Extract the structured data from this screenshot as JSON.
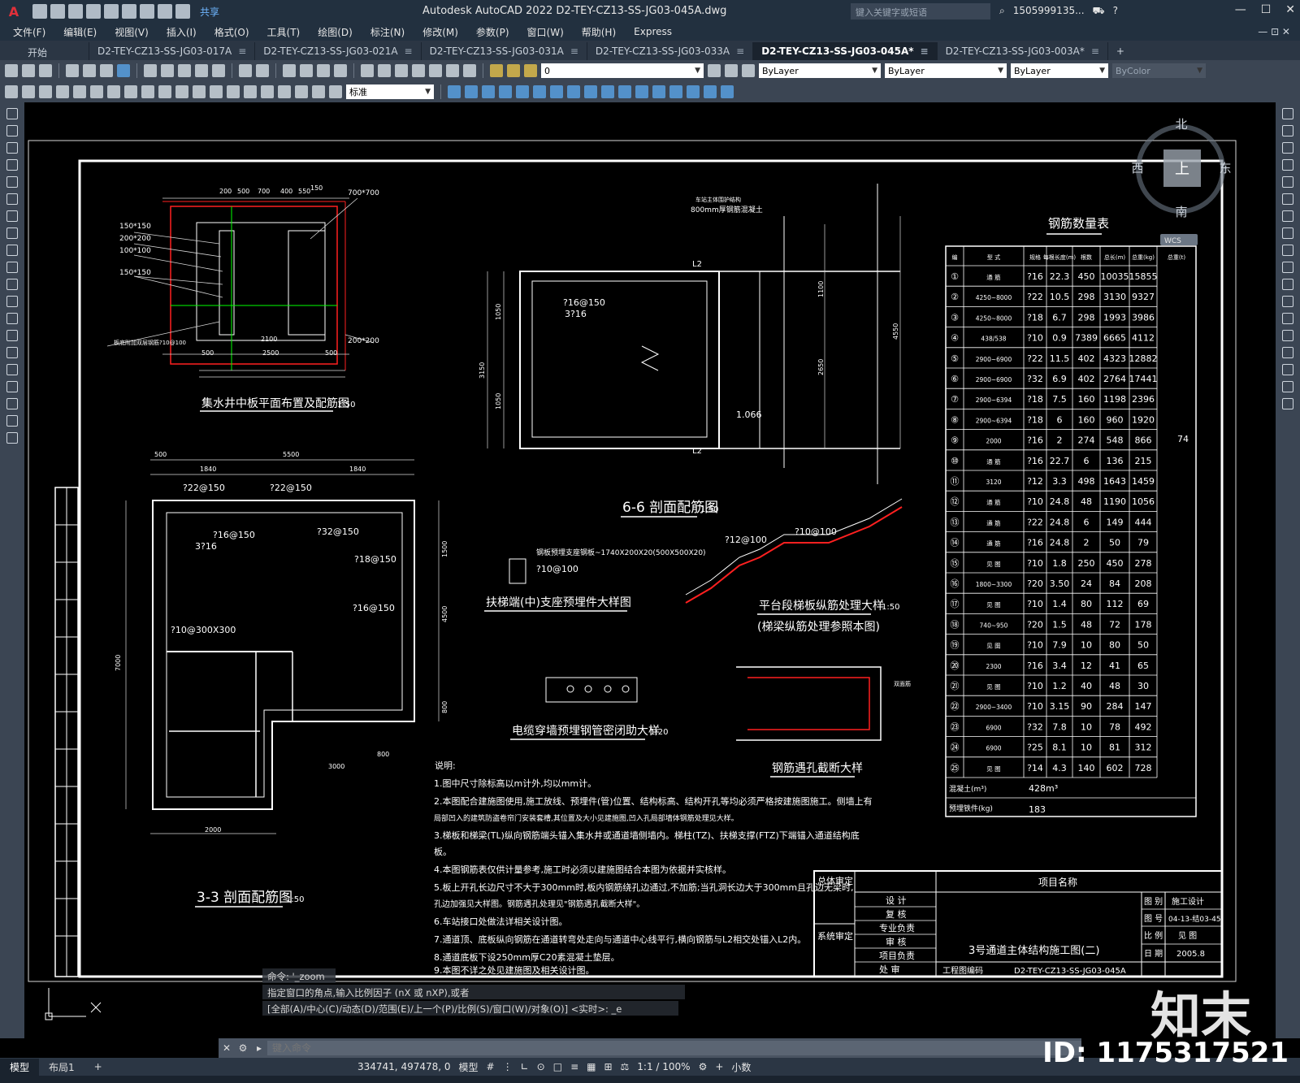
{
  "titlebar": {
    "logo": "A",
    "share": "共享",
    "title": "Autodesk AutoCAD 2022    D2-TEY-CZ13-SS-JG03-045A.dwg",
    "search_placeholder": "键入关键字或短语",
    "user": "1505999135...",
    "min": "—",
    "max": "☐",
    "close": "✕"
  },
  "menu": {
    "items": [
      "文件(F)",
      "编辑(E)",
      "视图(V)",
      "插入(I)",
      "格式(O)",
      "工具(T)",
      "绘图(D)",
      "标注(N)",
      "修改(M)",
      "参数(P)",
      "窗口(W)",
      "帮助(H)",
      "Express"
    ],
    "right": "— ⊡ ✕"
  },
  "tabs": {
    "start": "开始",
    "items": [
      {
        "label": "D2-TEY-CZ13-SS-JG03-017A",
        "active": false
      },
      {
        "label": "D2-TEY-CZ13-SS-JG03-021A",
        "active": false
      },
      {
        "label": "D2-TEY-CZ13-SS-JG03-031A",
        "active": false
      },
      {
        "label": "D2-TEY-CZ13-SS-JG03-033A",
        "active": false
      },
      {
        "label": "D2-TEY-CZ13-SS-JG03-045A*",
        "active": true
      },
      {
        "label": "D2-TEY-CZ13-SS-JG03-003A*",
        "active": false
      }
    ],
    "plus": "+"
  },
  "toolbar": {
    "layer": "0",
    "color": "ByLayer",
    "linetype": "ByLayer",
    "lineweight": "ByLayer",
    "plotstyle": "ByColor",
    "textstyle": "标准"
  },
  "viewcube": {
    "north": "北",
    "south": "南",
    "east": "东",
    "west": "西",
    "top": "上",
    "wcs": "WCS"
  },
  "drawing": {
    "t1": "集水井中板平面布置及配筋图",
    "t1_scale": "1:50",
    "t2": "3-3 剖面配筋图",
    "t2_scale": "1:50",
    "t3": "6-6 剖面配筋图",
    "t3_scale": "1:50",
    "t4": "扶梯端(中)支座预埋件大样图",
    "t5": "平台段梯板纵筋处理大样",
    "t5_scale": "1:50",
    "t5_sub": "(梯梁纵筋处理参照本图)",
    "t6": "电缆穿墙预埋钢管密闭助大样",
    "t6_scale": "1:20",
    "t7": "钢筋遇孔截断大样",
    "notes_title": "说明:",
    "notes": [
      "1.图中尺寸除标高以m计外,均以mm计。",
      "2.本图配合建施图使用,施工放线、预埋件(管)位置、结构标高、结构开孔等均必须严格按建施图施工。侧墙上有",
      "局部凹入的建筑防盗卷帘门安装套槽,其位置及大小见建施图,凹入孔局部墙体钢筋处理见大样。",
      "3.梯板和梯梁(TL)纵向钢筋端头锚入集水井或通道墙侧墙内。梯柱(TZ)、扶梯支撑(FTZ)下端锚入通道结构底",
      "板。",
      "4.本图钢筋表仅供计量参考,施工时必须以建施图结合本图为依据并实核样。",
      "5.板上开孔长边尺寸不大于300mm时,板内钢筋绕孔边通过,不加筋;当孔洞长边大于300mm且孔边无梁时,",
      "孔边加强见大样图。钢筋遇孔处理见\"钢筋遇孔截断大样\"。",
      "6.车站接口处做法详相关设计图。",
      "7.通道顶、底板纵向钢筋在通道转弯处走向与通道中心线平行,横向钢筋与L2相交处锚入L2内。",
      "8.通道底板下设250mm厚C20素混凝土垫层。",
      "9.本图不详之处见建施图及相关设计图。"
    ],
    "rebar_table": {
      "title": "钢筋数量表",
      "headers": [
        "编",
        "型 式",
        "规格",
        "每根长度(m)",
        "根数",
        "总长(m)",
        "总重(kg)",
        "总重(t)"
      ],
      "rows": [
        [
          "①",
          "通 筋",
          "?16",
          "22.3",
          "450",
          "10035",
          "15855"
        ],
        [
          "②",
          "4250~8000",
          "?22",
          "10.5",
          "298",
          "3130",
          "9327"
        ],
        [
          "③",
          "4250~8000",
          "?18",
          "6.7",
          "298",
          "1993",
          "3986"
        ],
        [
          "④",
          "438/538",
          "?10",
          "0.9",
          "7389",
          "6665",
          "4112"
        ],
        [
          "⑤",
          "2900~6900",
          "?22",
          "11.5",
          "402",
          "4323",
          "12882"
        ],
        [
          "⑥",
          "2900~6900",
          "?32",
          "6.9",
          "402",
          "2764",
          "17441"
        ],
        [
          "⑦",
          "2900~6394",
          "?18",
          "7.5",
          "160",
          "1198",
          "2396"
        ],
        [
          "⑧",
          "2900~6394",
          "?18",
          "6",
          "160",
          "960",
          "1920"
        ],
        [
          "⑨",
          "2000",
          "?16",
          "2",
          "274",
          "548",
          "866"
        ],
        [
          "⑩",
          "通 筋",
          "?16",
          "22.7",
          "6",
          "136",
          "215"
        ],
        [
          "⑪",
          "3120",
          "?12",
          "3.3",
          "498",
          "1643",
          "1459"
        ],
        [
          "⑫",
          "通 筋",
          "?10",
          "24.8",
          "48",
          "1190",
          "1056"
        ],
        [
          "⑬",
          "通 筋",
          "?22",
          "24.8",
          "6",
          "149",
          "444"
        ],
        [
          "⑭",
          "通 筋",
          "?16",
          "24.8",
          "2",
          "50",
          "79"
        ],
        [
          "⑮",
          "见 图",
          "?10",
          "1.8",
          "250",
          "450",
          "278"
        ],
        [
          "⑯",
          "1800~3300",
          "?20",
          "3.50",
          "24",
          "84",
          "208"
        ],
        [
          "⑰",
          "见 图",
          "?10",
          "1.4",
          "80",
          "112",
          "69"
        ],
        [
          "⑱",
          "740~950",
          "?20",
          "1.5",
          "48",
          "72",
          "178"
        ],
        [
          "⑲",
          "见 图",
          "?10",
          "7.9",
          "10",
          "80",
          "50"
        ],
        [
          "⑳",
          "2300",
          "?16",
          "3.4",
          "12",
          "41",
          "65"
        ],
        [
          "㉑",
          "见 图",
          "?10",
          "1.2",
          "40",
          "48",
          "30"
        ],
        [
          "㉒",
          "2900~3400",
          "?10",
          "3.15",
          "90",
          "284",
          "147"
        ],
        [
          "㉓",
          "6900",
          "?32",
          "7.8",
          "10",
          "78",
          "492"
        ],
        [
          "㉔",
          "6900",
          "?25",
          "8.1",
          "10",
          "81",
          "312"
        ],
        [
          "㉕",
          "见 图",
          "?14",
          "4.3",
          "140",
          "602",
          "728"
        ]
      ],
      "total_t": "74",
      "concrete_label": "混凝土(m³)",
      "concrete_value": "428m³",
      "steel_label": "预埋铁件(kg)",
      "steel_value": "183"
    },
    "titleblock": {
      "approve1": "总体审定",
      "approve2": "系统审定",
      "project_name": "项目名称",
      "design": "设 计",
      "check": "复 核",
      "lead": "专业负责",
      "review": "审 核",
      "proj_lead": "项目负责",
      "chief": "处 审",
      "drawing_title": "3号通道主体结构施工图(二)",
      "code_label": "工程图编码",
      "code": "D2-TEY-CZ13-SS-JG03-045A",
      "stage_label": "图 别",
      "stage": "施工设计",
      "num_label": "图 号",
      "num": "04-13-结03-45",
      "scale_label": "比 例",
      "scale": "见 图",
      "date_label": "日 期",
      "date": "2005.8"
    },
    "dims": {
      "d200": "200",
      "d500": "500",
      "d700": "700",
      "d400": "400",
      "d550": "550",
      "d150": "150",
      "d2100": "2100",
      "d2500": "2500",
      "d5500": "5500",
      "d1840": "1840",
      "d7000": "7000",
      "d3000": "3000",
      "d2000": "2000",
      "d4500": "4500",
      "d1500": "1500",
      "d800": "800",
      "d3150": "3150",
      "d1050": "1050",
      "d600": "600",
      "d4550": "4550",
      "d1100": "1100",
      "d2650": "2650",
      "d1066": "1.066",
      "s150": "150*150",
      "s200": "200*200",
      "s100": "100*100",
      "s700": "700*700",
      "s200b": "200*200",
      "r1": "?22@150",
      "r2": "?22@150",
      "r3": "?16@150",
      "r4": "?32@150",
      "r5": "?18@150",
      "r6": "?16@150",
      "r7": "?10@300X300",
      "r8": "3?16",
      "r9": "?16@150",
      "r10": "3?16",
      "r11": "?10@100",
      "r12": "?12@100",
      "r13": "?10@100",
      "r14": "钢板预埋支座钢板~1740X200X20(500X500X20)",
      "lbl1": "L2",
      "lbl2": "800mm厚钢筋混凝土",
      "lbl3": "车站主体围护结构",
      "lbl4": "双面筋",
      "lbl5": "板底附加双层钢筋?10@100"
    }
  },
  "command": {
    "hist1": "命令: '_zoom",
    "hist2": "指定窗口的角点,输入比例因子 (nX 或 nXP),或者",
    "hist3": "[全部(A)/中心(C)/动态(D)/范围(E)/上一个(P)/比例(S)/窗口(W)/对象(O)] <实时>: _e",
    "placeholder": "键入命令"
  },
  "layout": {
    "model": "模型",
    "layout1": "布局1",
    "add": "+"
  },
  "status": {
    "coords": "334741, 497478, 0",
    "mode": "模型",
    "scale": "1:1 / 100%",
    "units": "小数"
  },
  "watermark": {
    "logo": "知末",
    "id": "ID: 1175317521"
  },
  "colors": {
    "accent": "#5aa4e8",
    "red": "#ff2020",
    "yellow": "#ffff00",
    "green": "#00ff00",
    "bg": "#000000"
  }
}
